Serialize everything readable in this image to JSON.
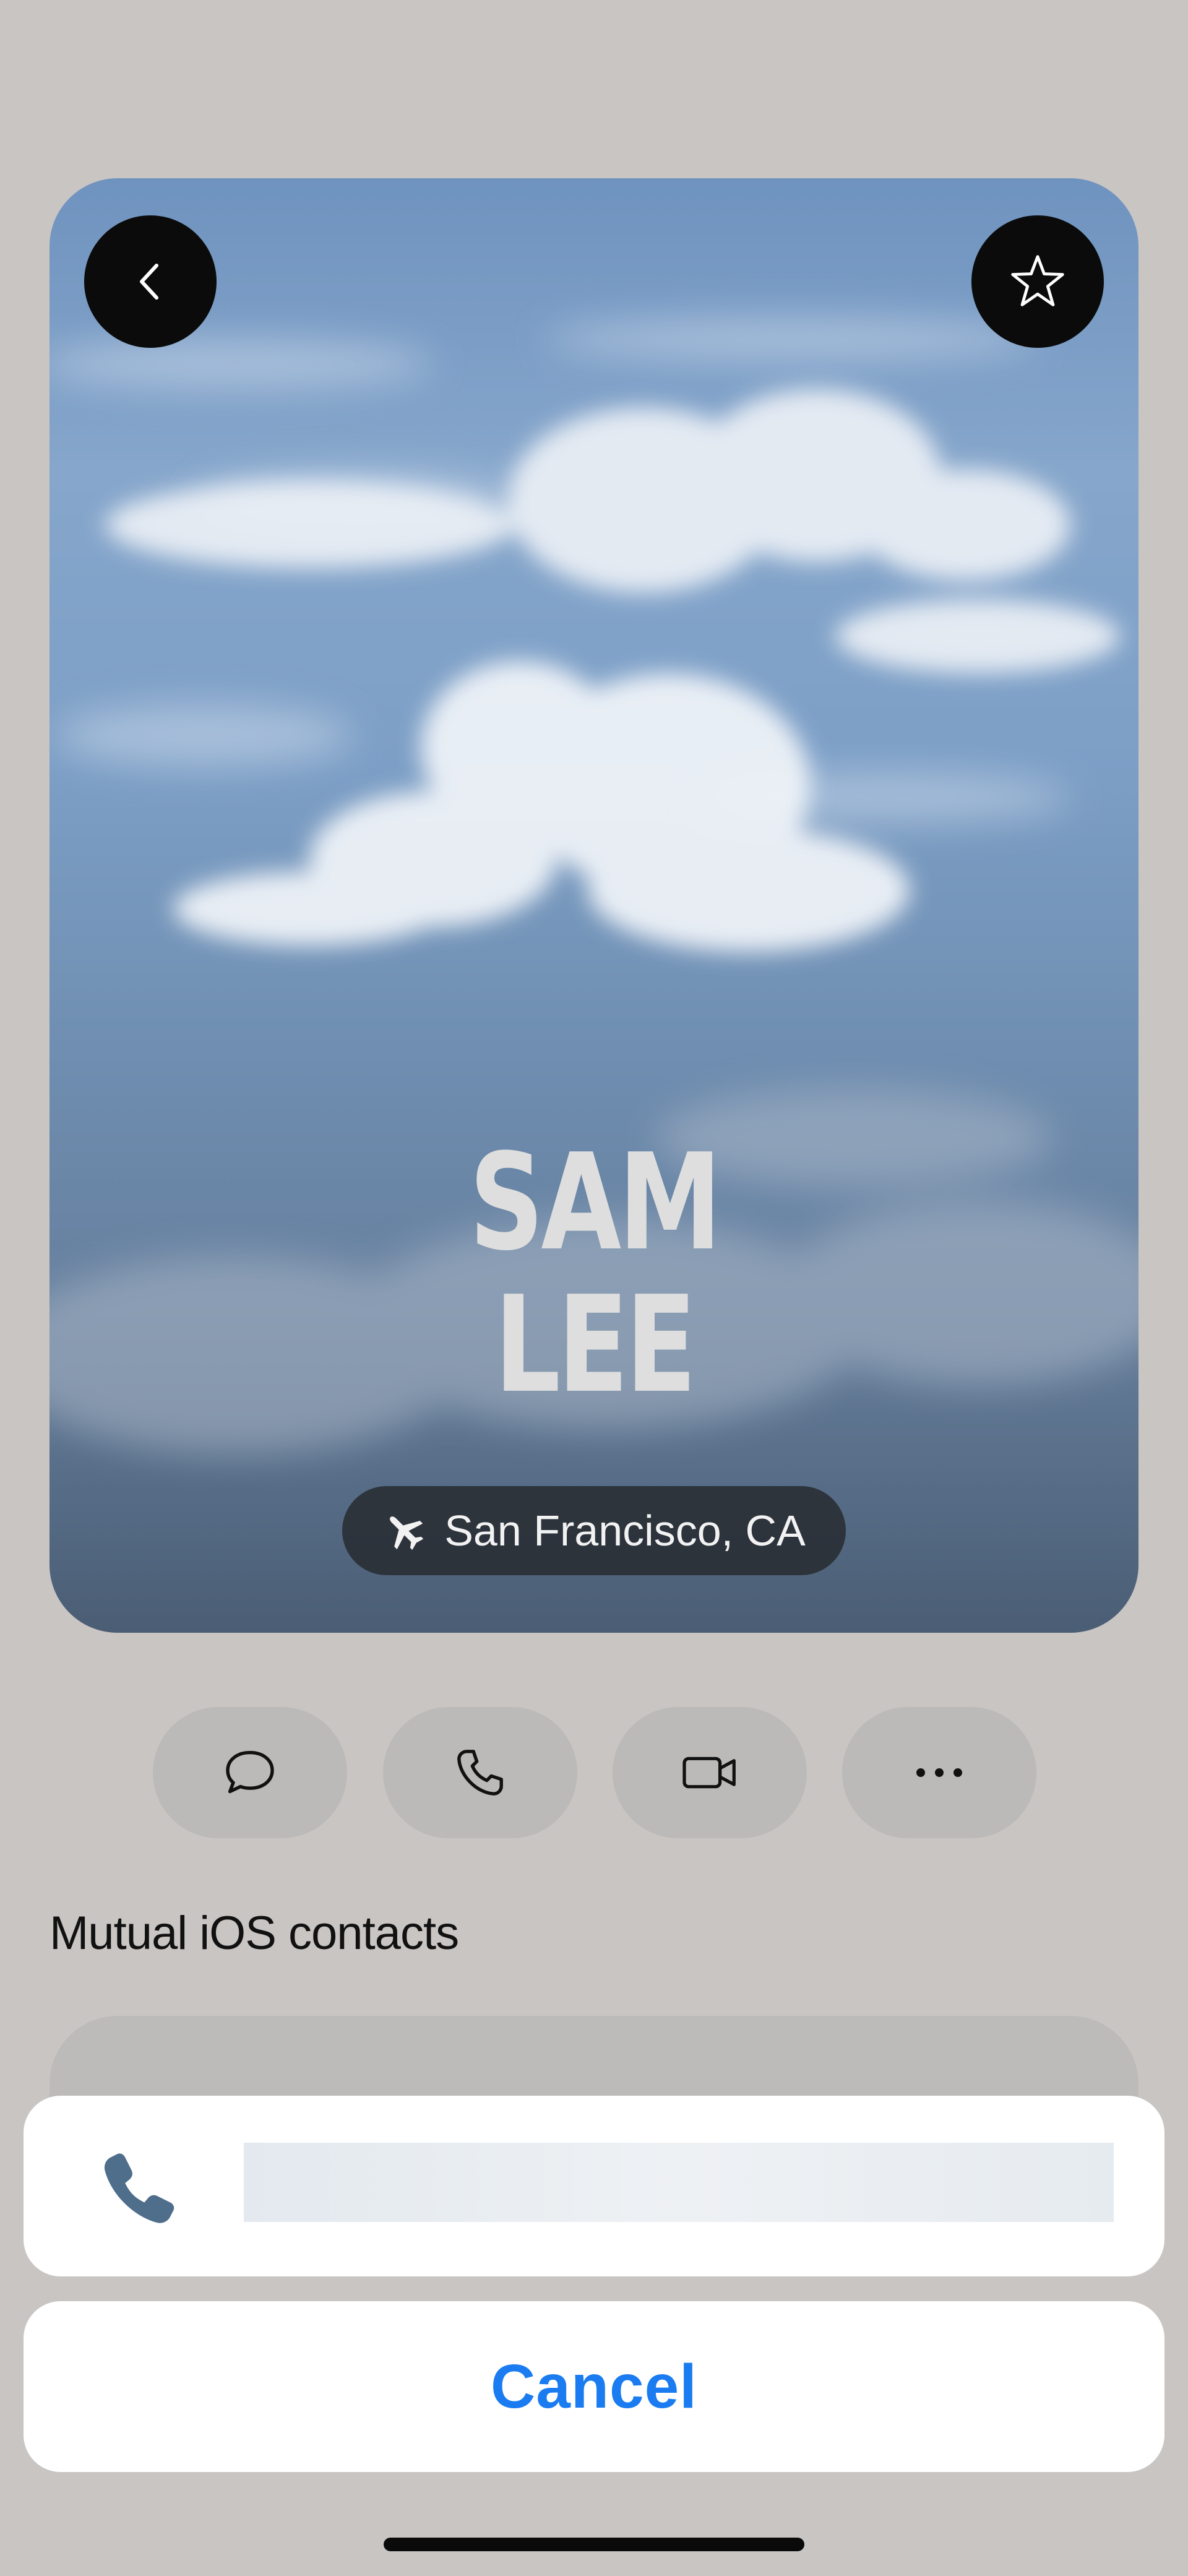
{
  "profile": {
    "first_name": "SAM",
    "last_name": "LEE",
    "location": "San Francisco, CA",
    "back_icon": "chevron-left-icon",
    "favorite_icon": "star-outline-icon",
    "location_icon": "airplane-icon"
  },
  "actions": [
    {
      "name": "message",
      "icon": "message-bubble-icon"
    },
    {
      "name": "call",
      "icon": "phone-icon"
    },
    {
      "name": "video",
      "icon": "video-camera-icon"
    },
    {
      "name": "more",
      "icon": "ellipsis-icon"
    }
  ],
  "mutual_section": {
    "title": "Mutual iOS contacts"
  },
  "action_sheet": {
    "option_icon": "phone-icon",
    "cancel_label": "Cancel"
  },
  "colors": {
    "accent": "#1a7cf0",
    "background": "#c8c5c3"
  }
}
